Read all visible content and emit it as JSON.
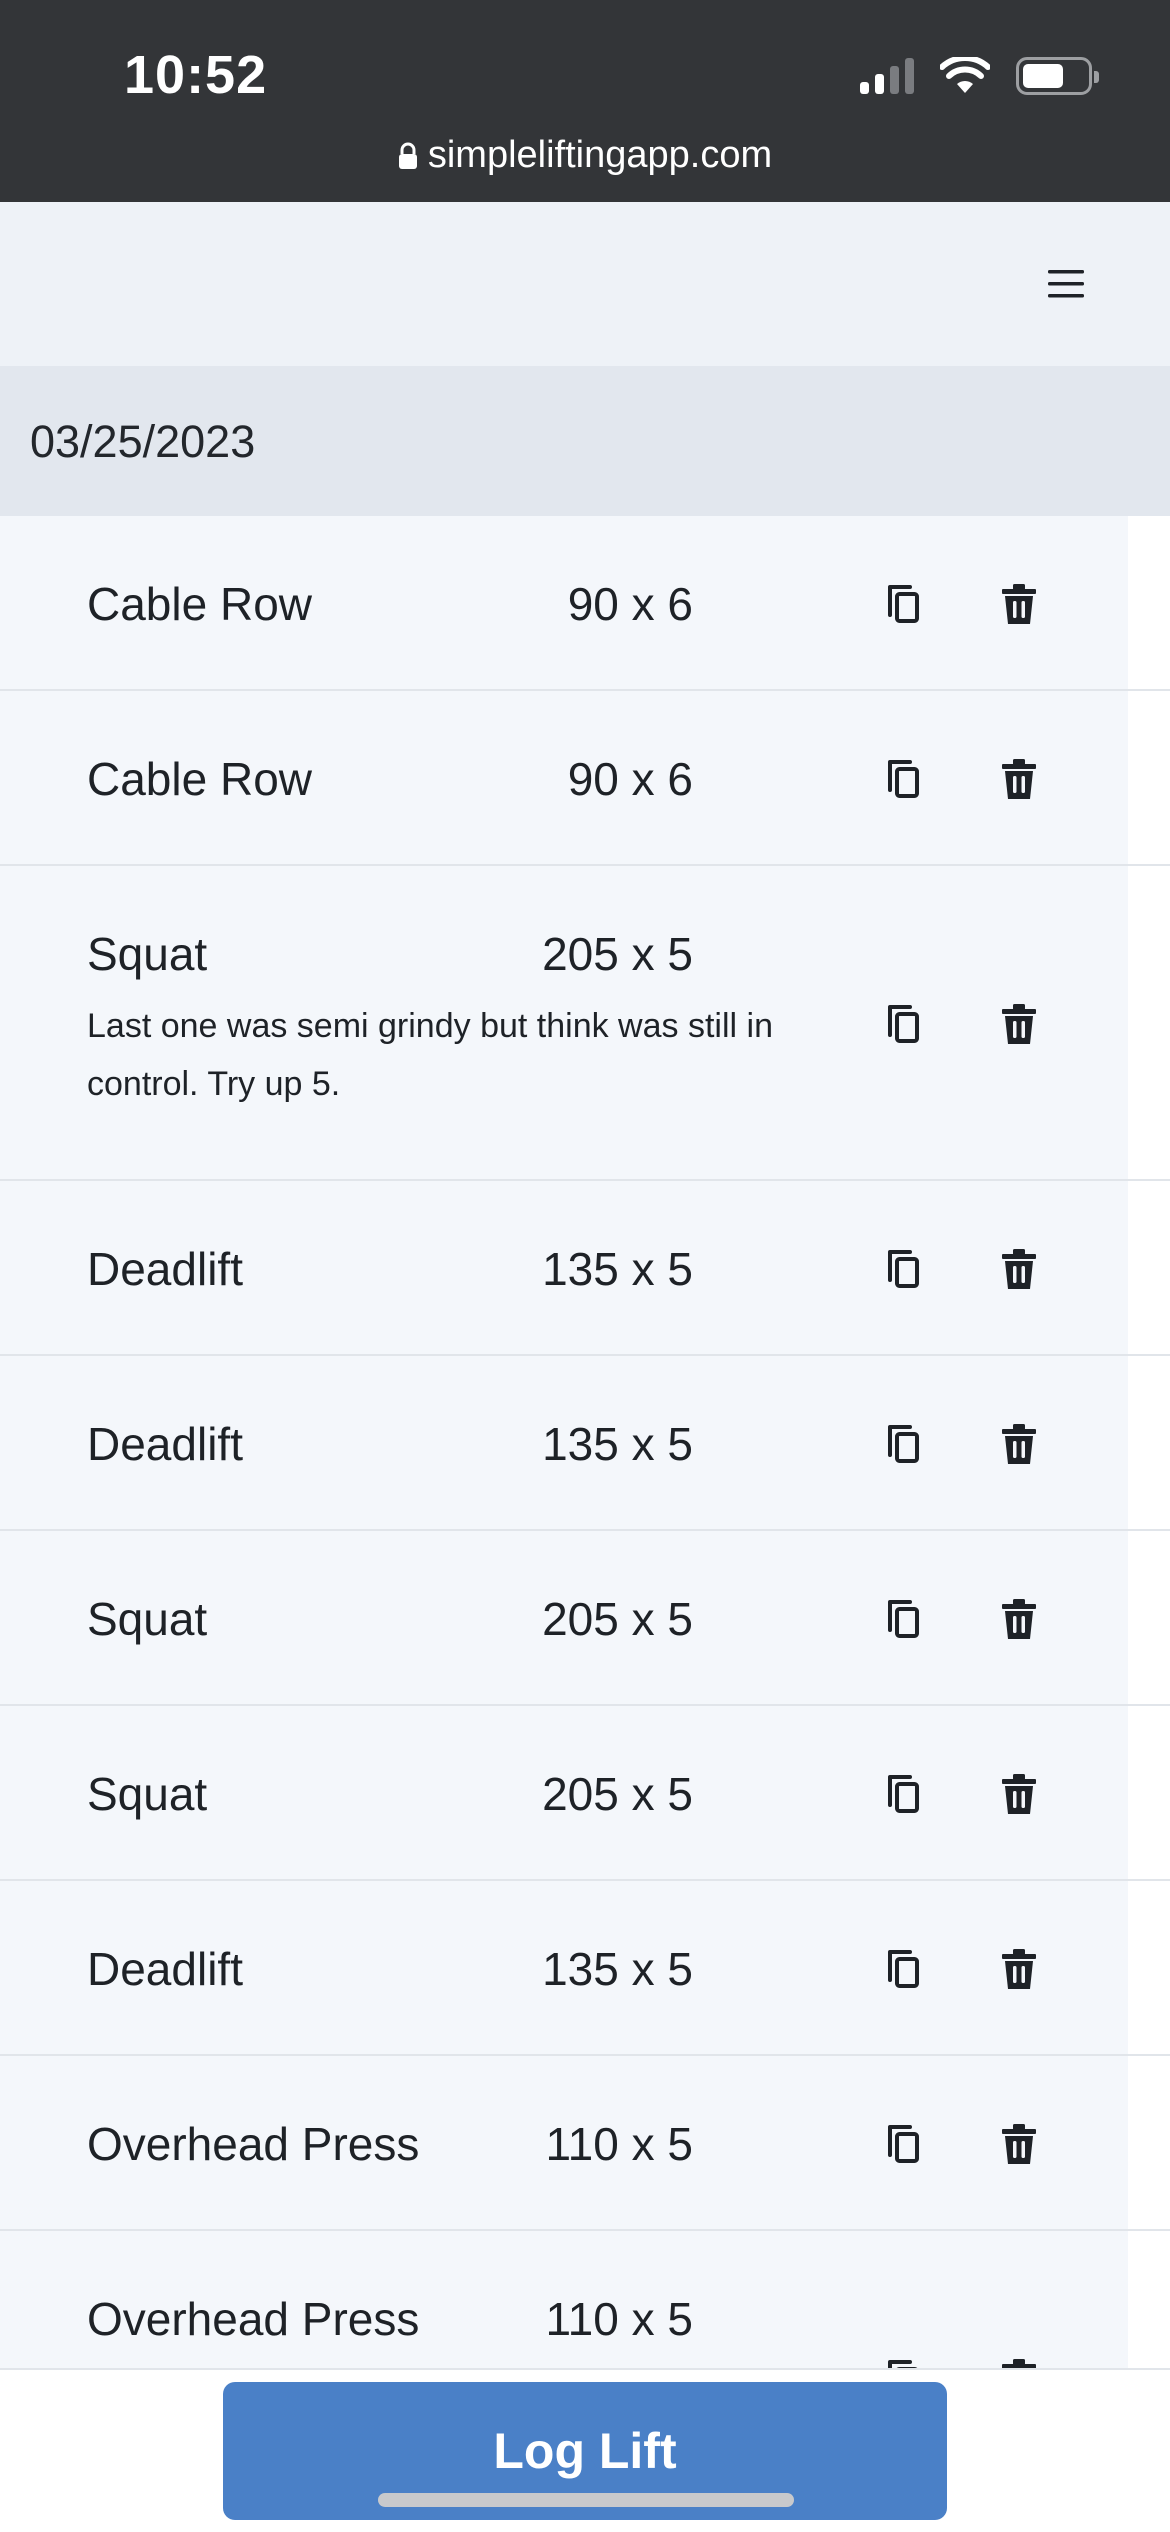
{
  "status_bar": {
    "time": "10:52",
    "url": "simpleliftingapp.com"
  },
  "header": {
    "menu_icon": "hamburger-menu-icon"
  },
  "date_group": {
    "date": "03/25/2023"
  },
  "lifts": [
    {
      "exercise": "Cable Row",
      "sets": "90 x 6",
      "note": ""
    },
    {
      "exercise": "Cable Row",
      "sets": "90 x 6",
      "note": ""
    },
    {
      "exercise": "Squat",
      "sets": "205 x 5",
      "note": "Last one was semi grindy but think was still in control. Try up 5."
    },
    {
      "exercise": "Deadlift",
      "sets": "135 x 5",
      "note": ""
    },
    {
      "exercise": "Deadlift",
      "sets": "135 x 5",
      "note": ""
    },
    {
      "exercise": "Squat",
      "sets": "205 x 5",
      "note": ""
    },
    {
      "exercise": "Squat",
      "sets": "205 x 5",
      "note": ""
    },
    {
      "exercise": "Deadlift",
      "sets": "135 x 5",
      "note": ""
    },
    {
      "exercise": "Overhead Press",
      "sets": "110 x 5",
      "note": ""
    },
    {
      "exercise": "Overhead Press",
      "sets": "110 x 5",
      "note": ""
    }
  ],
  "row_icons": {
    "copy": "copy-icon",
    "delete": "trash-icon"
  },
  "footer": {
    "log_button": "Log Lift"
  },
  "colors": {
    "accent": "#4a80c7",
    "status_bar": "#333538",
    "row_bg": "#f4f7fb",
    "date_bg": "#e2e7ee"
  }
}
